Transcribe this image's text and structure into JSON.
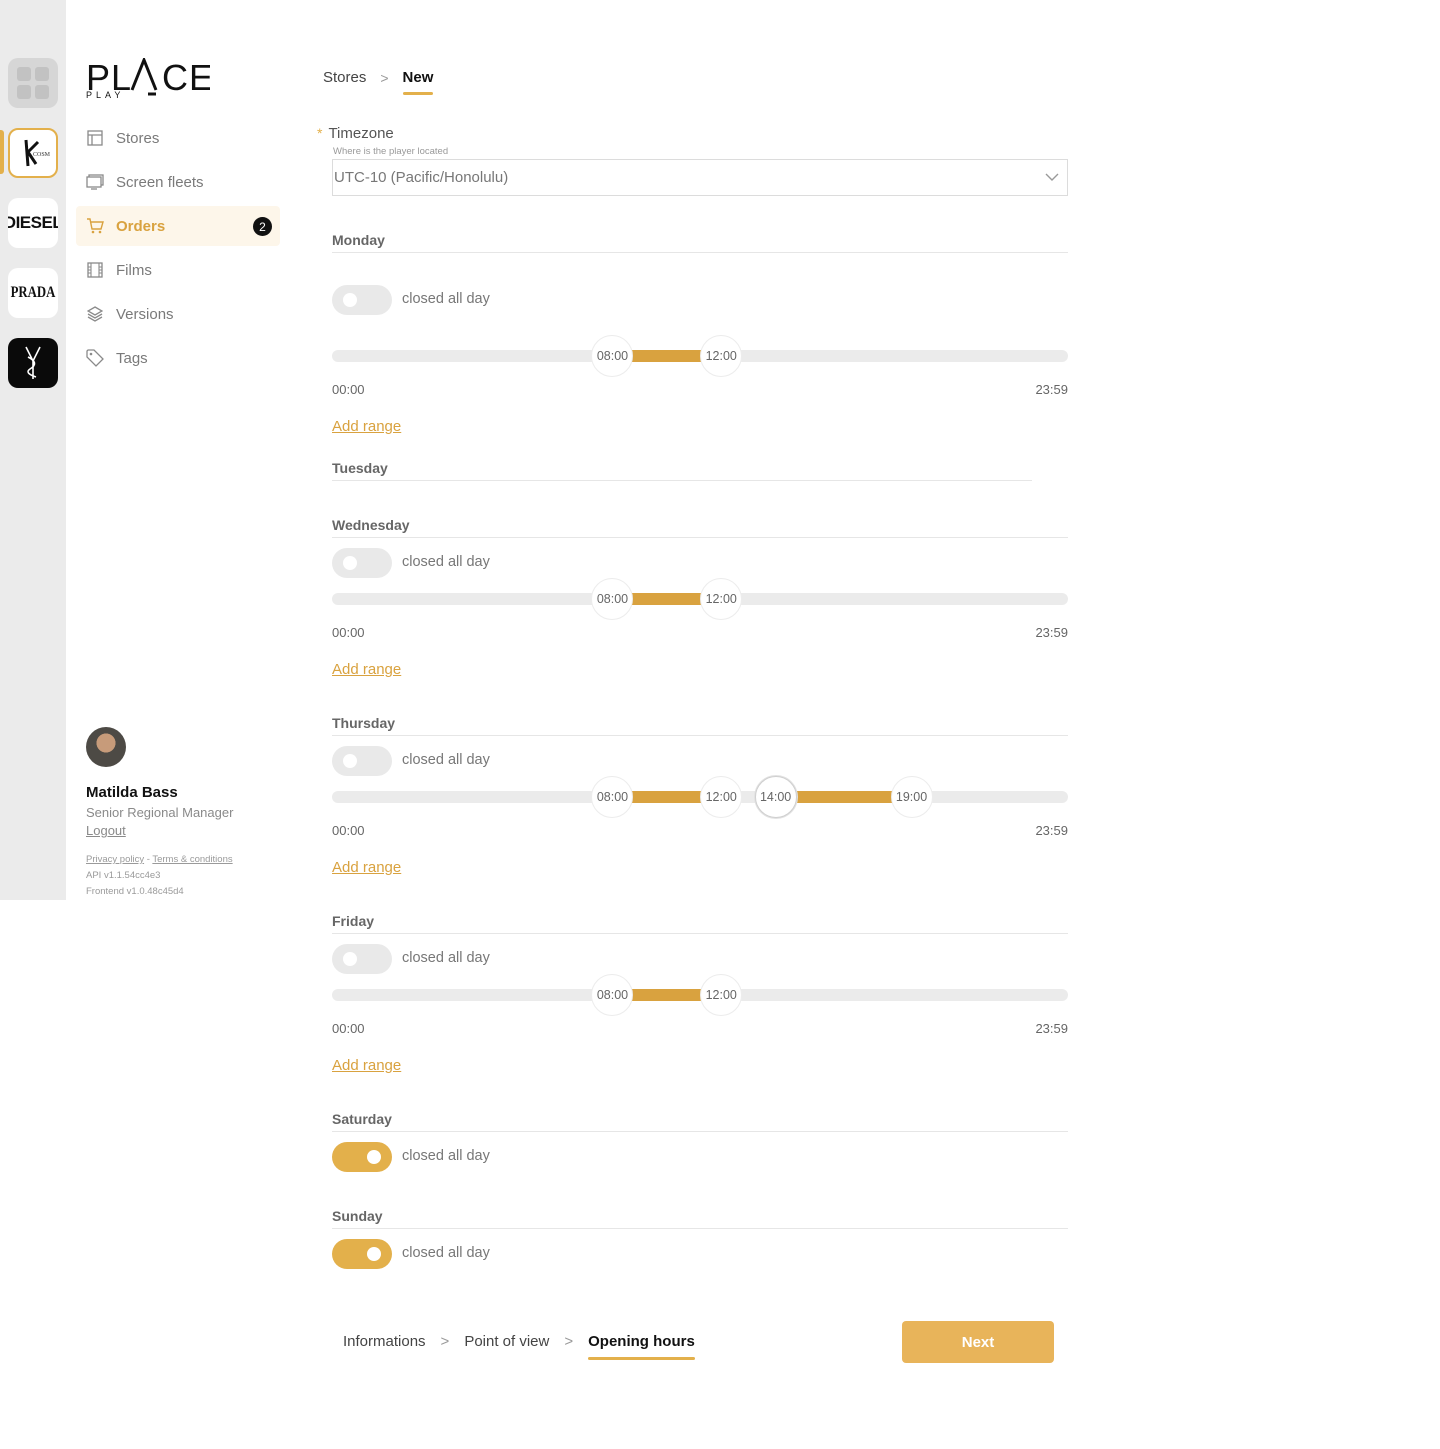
{
  "colors": {
    "accent": "#e3b04b",
    "accent_dark": "#d9a23f",
    "track": "#ebebeb"
  },
  "brands": [
    {
      "name": "all-brands",
      "text": ""
    },
    {
      "name": "kcosmetics",
      "text": ""
    },
    {
      "name": "diesel",
      "text": "DIESEL"
    },
    {
      "name": "prada",
      "text": "PRADA"
    },
    {
      "name": "ysl",
      "text": ""
    }
  ],
  "logo": {
    "main": "PLACE",
    "sub": "PLAY"
  },
  "nav": {
    "items": [
      {
        "label": "Stores",
        "icon": "store-icon"
      },
      {
        "label": "Screen fleets",
        "icon": "screen-icon"
      },
      {
        "label": "Orders",
        "icon": "cart-icon",
        "badge": "2"
      },
      {
        "label": "Films",
        "icon": "film-icon"
      },
      {
        "label": "Versions",
        "icon": "layers-icon"
      },
      {
        "label": "Tags",
        "icon": "tag-icon"
      }
    ]
  },
  "user": {
    "name": "Matilda Bass",
    "role": "Senior Regional Manager",
    "logout": "Logout",
    "privacy": "Privacy policy",
    "dash": " - ",
    "terms": "Terms & conditions",
    "api_version": "API v1.1.54cc4e3",
    "frontend_version": "Frontend v1.0.48c45d4"
  },
  "breadcrumb": {
    "parent": "Stores",
    "separator": ">",
    "current": "New"
  },
  "timezone": {
    "label": "Timezone",
    "required_mark": "*",
    "hint": "Where is the player located",
    "value": "UTC-10 (Pacific/Honolulu)"
  },
  "closed_label": "closed all day",
  "add_range_label": "Add range",
  "scale": {
    "min": "00:00",
    "max": "23:59"
  },
  "days": [
    {
      "name": "Monday",
      "closed": false,
      "ranges": [
        [
          "08:00",
          "12:00"
        ]
      ]
    },
    {
      "name": "Tuesday",
      "closed": false,
      "ranges": []
    },
    {
      "name": "Wednesday",
      "closed": false,
      "ranges": [
        [
          "08:00",
          "12:00"
        ]
      ]
    },
    {
      "name": "Thursday",
      "closed": false,
      "ranges": [
        [
          "08:00",
          "12:00"
        ],
        [
          "14:00",
          "19:00"
        ]
      ]
    },
    {
      "name": "Friday",
      "closed": false,
      "ranges": [
        [
          "08:00",
          "12:00"
        ]
      ]
    },
    {
      "name": "Saturday",
      "closed": true,
      "ranges": []
    },
    {
      "name": "Sunday",
      "closed": true,
      "ranges": []
    }
  ],
  "stepper": {
    "steps": [
      "Informations",
      "Point of view",
      "Opening hours"
    ],
    "separator": ">",
    "current": "Opening hours"
  },
  "next_label": "Next"
}
